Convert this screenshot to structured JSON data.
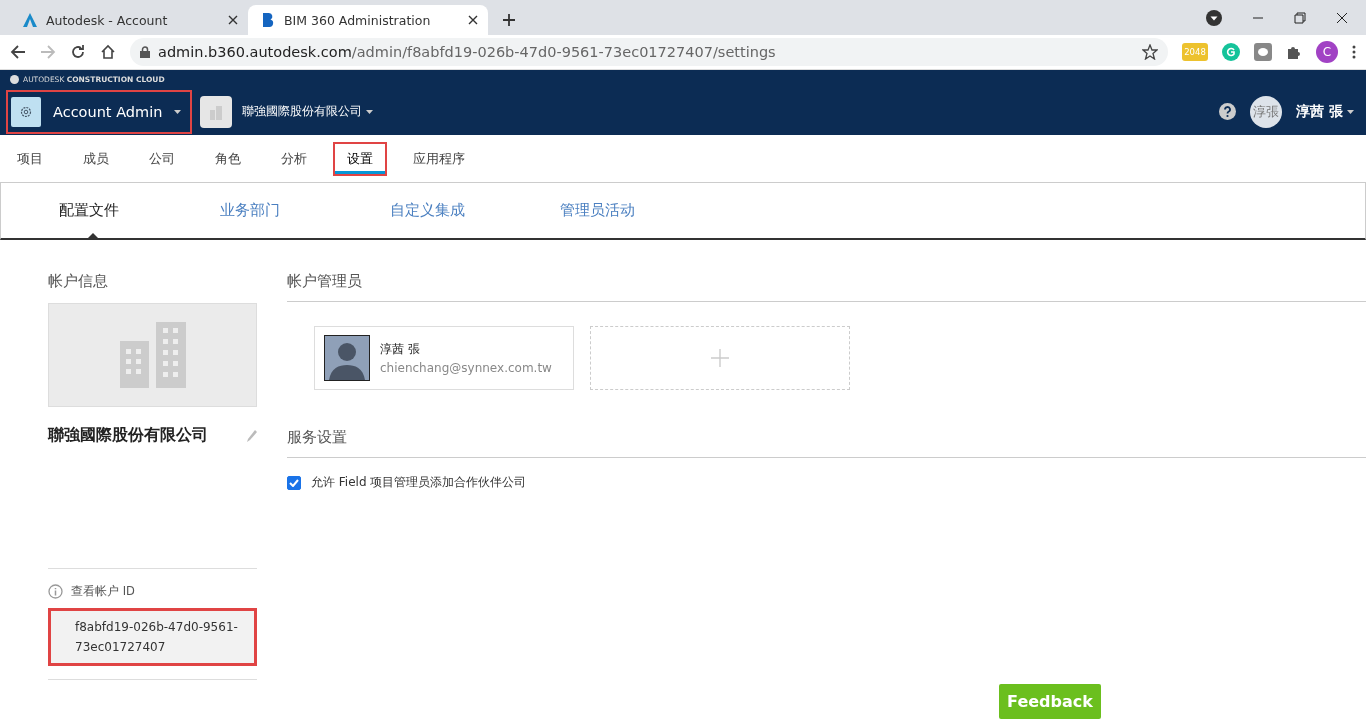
{
  "browser": {
    "tabs": [
      {
        "title": "Autodesk - Account",
        "selected": false,
        "kind": "autodesk"
      },
      {
        "title": "BIM 360 Administration",
        "selected": true,
        "kind": "bim"
      }
    ],
    "url": {
      "host": "admin.b360.autodesk.com",
      "path": "/admin/f8abfd19-026b-47d0-9561-73ec01727407/settings"
    },
    "extensions": [
      {
        "kind": "game",
        "label": "2048"
      },
      {
        "kind": "grammarly"
      },
      {
        "kind": "chat"
      },
      {
        "kind": "puzzle"
      },
      {
        "kind": "profile",
        "label": "C"
      }
    ]
  },
  "header": {
    "brand": {
      "light": "AUTODESK",
      "bold": "CONSTRUCTION CLOUD"
    },
    "module": {
      "label": "Account Admin",
      "highlighted": true
    },
    "account": "聯強國際股份有限公司",
    "avatar_text": "淳張",
    "user": "淳茜 張"
  },
  "nav": [
    {
      "label": "项目",
      "selected": false,
      "highlighted": false
    },
    {
      "label": "成员",
      "selected": false,
      "highlighted": false
    },
    {
      "label": "公司",
      "selected": false,
      "highlighted": false
    },
    {
      "label": "角色",
      "selected": false,
      "highlighted": false
    },
    {
      "label": "分析",
      "selected": false,
      "highlighted": false
    },
    {
      "label": "设置",
      "selected": true,
      "highlighted": true
    },
    {
      "label": "应用程序",
      "selected": false,
      "highlighted": false
    }
  ],
  "subtabs": [
    {
      "label": "配置文件",
      "selected": true
    },
    {
      "label": "业务部门",
      "selected": false
    },
    {
      "label": "自定义集成",
      "selected": false
    },
    {
      "label": "管理员活动",
      "selected": false
    }
  ],
  "account_info": {
    "heading": "帐户信息",
    "name": "聯強國際股份有限公司",
    "id_label": "查看帐户 ID",
    "id_value": "f8abfd19-026b-47d0-9561-73ec01727407",
    "id_highlighted": true
  },
  "admins": {
    "heading": "帐户管理员",
    "items": [
      {
        "name": "淳茜 張",
        "email": "chienchang@synnex.com.tw"
      }
    ]
  },
  "services": {
    "heading": "服务设置",
    "options": [
      {
        "label": "允许 Field 项目管理员添加合作伙伴公司",
        "checked": true
      }
    ]
  },
  "feedback": "Feedback"
}
